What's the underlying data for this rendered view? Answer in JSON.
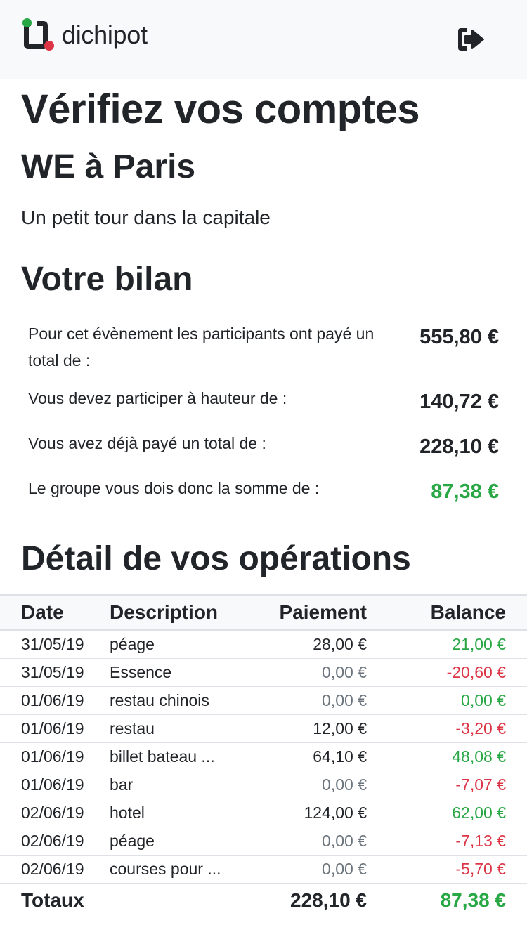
{
  "brand": {
    "name": "dichipot"
  },
  "icons": {
    "logout": "sign-out-icon",
    "logo": "dichipot-logo-icon"
  },
  "colors": {
    "positive": "#28a745",
    "negative": "#dc3545",
    "muted": "#6c757d",
    "navbar_bg": "#f8f9fa"
  },
  "page": {
    "title": "Vérifiez vos comptes",
    "event_name": "WE à Paris",
    "event_description": "Un petit tour dans la capitale"
  },
  "summary": {
    "heading": "Votre bilan",
    "rows": [
      {
        "label": "Pour cet évènement les participants ont payé un total de :",
        "amount": "555,80 €",
        "tone": "default"
      },
      {
        "label": "Vous devez participer à hauteur de :",
        "amount": "140,72 €",
        "tone": "default"
      },
      {
        "label": "Vous avez déjà payé un total de :",
        "amount": "228,10 €",
        "tone": "default"
      },
      {
        "label": "Le groupe vous dois donc la somme de :",
        "amount": "87,38 €",
        "tone": "positive"
      }
    ]
  },
  "operations": {
    "heading": "Détail de vos opérations",
    "columns": {
      "date": "Date",
      "description": "Description",
      "payment": "Paiement",
      "balance": "Balance"
    },
    "rows": [
      {
        "date": "31/05/19",
        "description": "péage",
        "payment": "28,00 €",
        "payment_muted": false,
        "balance": "21,00 €",
        "balance_tone": "positive"
      },
      {
        "date": "31/05/19",
        "description": "Essence",
        "payment": "0,00 €",
        "payment_muted": true,
        "balance": "-20,60 €",
        "balance_tone": "negative"
      },
      {
        "date": "01/06/19",
        "description": "restau chinois",
        "payment": "0,00 €",
        "payment_muted": true,
        "balance": "0,00 €",
        "balance_tone": "positive"
      },
      {
        "date": "01/06/19",
        "description": "restau",
        "payment": "12,00 €",
        "payment_muted": false,
        "balance": "-3,20 €",
        "balance_tone": "negative"
      },
      {
        "date": "01/06/19",
        "description": "billet bateau ...",
        "payment": "64,10 €",
        "payment_muted": false,
        "balance": "48,08 €",
        "balance_tone": "positive"
      },
      {
        "date": "01/06/19",
        "description": "bar",
        "payment": "0,00 €",
        "payment_muted": true,
        "balance": "-7,07 €",
        "balance_tone": "negative"
      },
      {
        "date": "02/06/19",
        "description": "hotel",
        "payment": "124,00 €",
        "payment_muted": false,
        "balance": "62,00 €",
        "balance_tone": "positive"
      },
      {
        "date": "02/06/19",
        "description": "péage",
        "payment": "0,00 €",
        "payment_muted": true,
        "balance": "-7,13 €",
        "balance_tone": "negative"
      },
      {
        "date": "02/06/19",
        "description": "courses pour ...",
        "payment": "0,00 €",
        "payment_muted": true,
        "balance": "-5,70 €",
        "balance_tone": "negative"
      }
    ],
    "totals": {
      "label": "Totaux",
      "payment": "228,10 €",
      "balance": "87,38 €",
      "balance_tone": "positive"
    }
  }
}
